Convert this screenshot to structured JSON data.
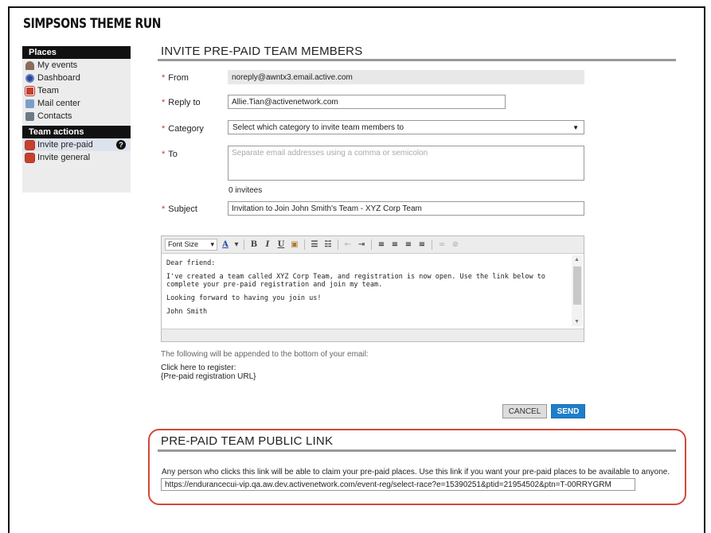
{
  "site": {
    "title": "SIMPSONS THEME RUN"
  },
  "sidebar": {
    "places_header": "Places",
    "places": [
      {
        "label": "My events",
        "icon": "bell-icon"
      },
      {
        "label": "Dashboard",
        "icon": "dashboard-icon"
      },
      {
        "label": "Team",
        "icon": "team-icon"
      },
      {
        "label": "Mail center",
        "icon": "mail-icon"
      },
      {
        "label": "Contacts",
        "icon": "contacts-icon"
      }
    ],
    "actions_header": "Team actions",
    "actions": [
      {
        "label": "Invite pre-paid",
        "icon": "invite-icon",
        "active": true,
        "help": "?"
      },
      {
        "label": "Invite general",
        "icon": "invite-icon",
        "active": false
      }
    ]
  },
  "invite": {
    "title": "INVITE PRE-PAID TEAM MEMBERS",
    "required_mark": "*",
    "from": {
      "label": "From",
      "value": "noreply@awntx3.email.active.com"
    },
    "reply_to": {
      "label": "Reply to",
      "value": "Allie.Tian@activenetwork.com"
    },
    "category": {
      "label": "Category",
      "value": "Select which category to invite team members to",
      "arrow": "▼"
    },
    "to": {
      "label": "To",
      "placeholder": "Separate email addresses using a comma or semicolon",
      "count": "0 invitees"
    },
    "subject": {
      "label": "Subject",
      "value": "Invitation to Join John Smith's Team - XYZ Corp Team"
    }
  },
  "editor": {
    "font_size_label": "Font Size",
    "body": {
      "greeting": "Dear friend:",
      "paragraph1": "I've created a team called XYZ Corp Team, and registration is now open. Use the link below to complete your pre-paid registration and join my team.",
      "paragraph2": "Looking forward to having you join us!",
      "signature": "John Smith"
    }
  },
  "appended": {
    "note": "The following will be appended to the bottom of your email:",
    "line1": "Click here to register:",
    "line2": "{Pre-paid registration URL}"
  },
  "actions": {
    "cancel": "CANCEL",
    "send": "SEND"
  },
  "public_link": {
    "title": "PRE-PAID TEAM PUBLIC LINK",
    "description": "Any person who clicks this link will be able to claim your pre-paid places. Use this link if you want your pre-paid places to be available to anyone.",
    "url": "https://endurancecui-vip.qa.aw.dev.activenetwork.com/event-reg/select-race?e=15390251&ptid=21954502&ptn=T-00RRYGRM"
  },
  "colors": {
    "send": "#1f7ec9",
    "highlight": "#d04a3a",
    "required": "#d0342c"
  }
}
